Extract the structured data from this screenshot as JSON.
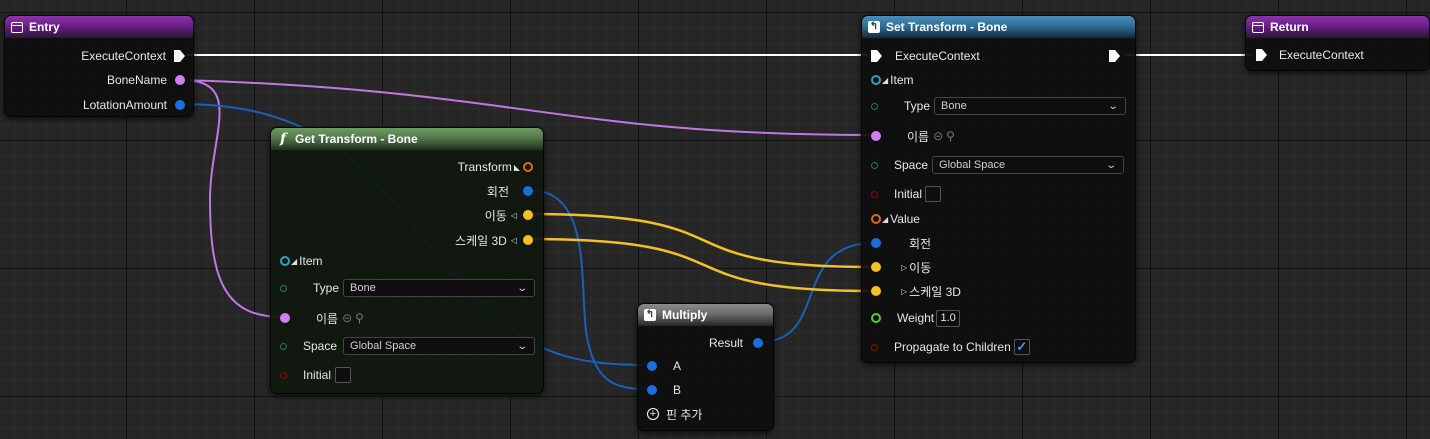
{
  "colors": {
    "exec": "#ffffff",
    "name_pin": "#d27ef3",
    "float_pin": "#1b6fdc",
    "vector_pin": "#f6bf24",
    "struct_pin": "#e06a14",
    "item_pin": "#27a5c7",
    "enum_pin": "#1e7a66",
    "bool_pin": "#8a0b0b",
    "weight_pin": "#47d32a",
    "wire_exec": "#ffffff",
    "wire_name": "#c277e6",
    "wire_float": "#1a5fb8",
    "wire_vector": "#f2c12a"
  },
  "entry": {
    "title": "Entry",
    "pins": [
      {
        "label": "ExecuteContext",
        "type": "exec"
      },
      {
        "label": "BoneName",
        "type": "name"
      },
      {
        "label": "LotationAmount",
        "type": "float"
      }
    ]
  },
  "get_transform": {
    "title": "Get Transform - Bone",
    "outputs": [
      {
        "label": "Transform",
        "icon": "struct"
      },
      {
        "label": "회전",
        "icon": "float"
      },
      {
        "label": "이동",
        "icon": "vector"
      },
      {
        "label": "스케일 3D",
        "icon": "vector"
      }
    ],
    "item_label": "Item",
    "type_label": "Type",
    "type_value": "Bone",
    "name_label": "이름",
    "space_label": "Space",
    "space_value": "Global Space",
    "initial_label": "Initial"
  },
  "multiply": {
    "title": "Multiply",
    "result_label": "Result",
    "a_label": "A",
    "b_label": "B",
    "add_pin_label": "핀 추가"
  },
  "set_transform": {
    "title": "Set Transform - Bone",
    "exec_label": "ExecuteContext",
    "item_label": "Item",
    "type_label": "Type",
    "type_value": "Bone",
    "name_label": "이름",
    "space_label": "Space",
    "space_value": "Global Space",
    "initial_label": "Initial",
    "value_label": "Value",
    "rotation_label": "회전",
    "translation_label": "이동",
    "scale_label": "스케일 3D",
    "weight_label": "Weight",
    "weight_value": "1.0",
    "propagate_label": "Propagate to Children",
    "propagate_checked": true
  },
  "return_node": {
    "title": "Return",
    "exec_label": "ExecuteContext"
  }
}
